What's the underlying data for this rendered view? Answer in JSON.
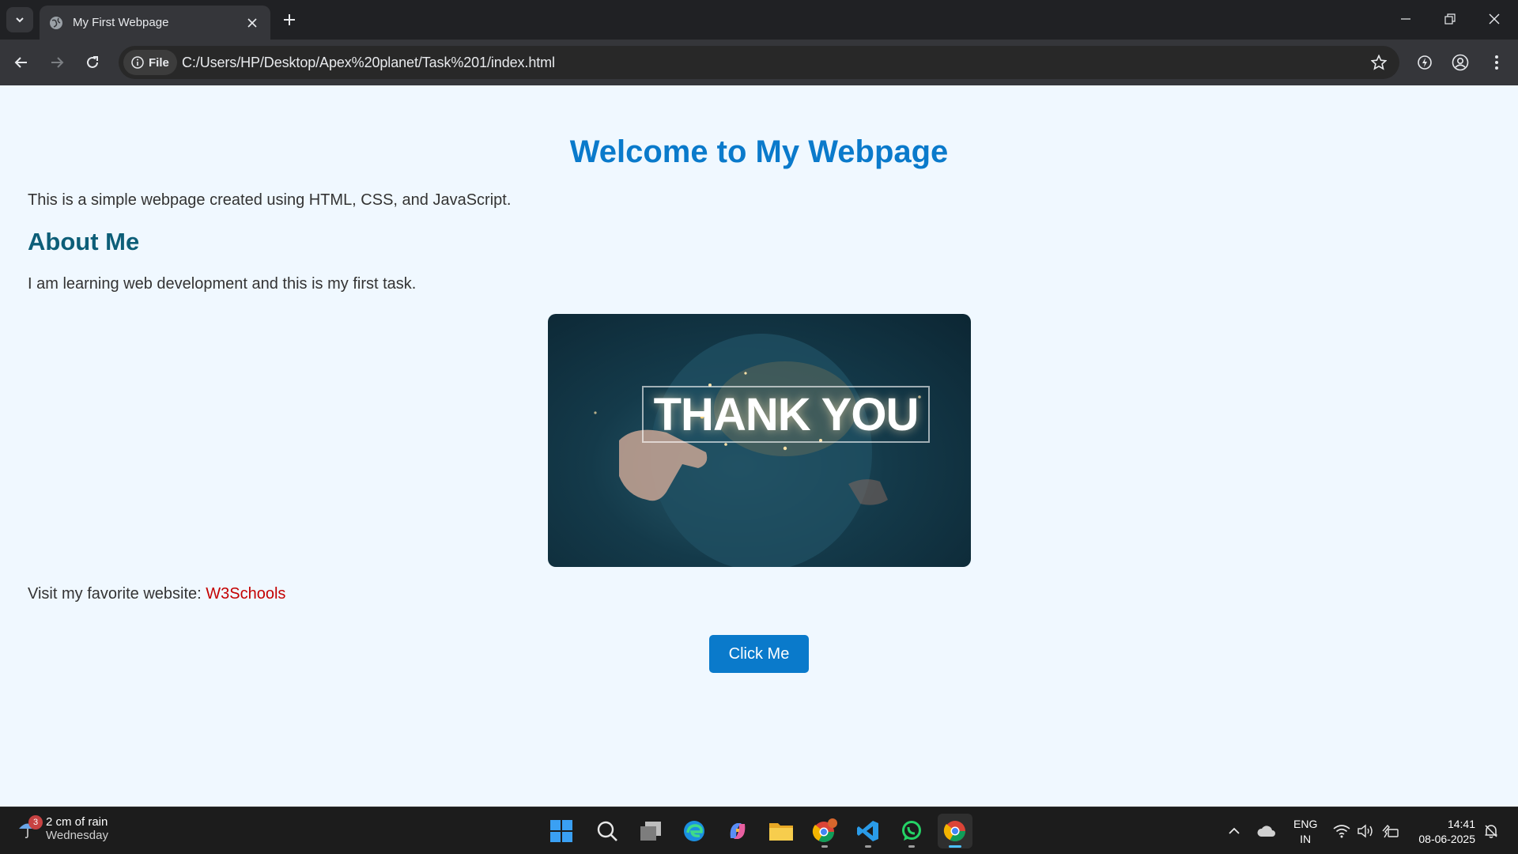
{
  "browser": {
    "tab_title": "My First Webpage",
    "site_chip": "File",
    "url": "C:/Users/HP/Desktop/Apex%20planet/Task%201/index.html"
  },
  "page": {
    "title": "Welcome to My Webpage",
    "intro": "This is a simple webpage created using HTML, CSS, and JavaScript.",
    "about_heading": "About Me",
    "about_text": "I am learning web development and this is my first task.",
    "image_text": "THANK YOU",
    "visit_prefix": "Visit my favorite website: ",
    "visit_link": "W3Schools",
    "button_label": "Click Me"
  },
  "colors": {
    "page_bg": "#f0f8ff",
    "title": "#0a7acb",
    "heading": "#0d5e78",
    "link": "#c40000",
    "button": "#0a7acb"
  },
  "taskbar": {
    "weather_badge": "3",
    "weather_main": "2 cm of rain",
    "weather_sub": "Wednesday",
    "apps": [
      "start-icon",
      "search-icon",
      "task-view-icon",
      "edge-icon",
      "copilot-icon",
      "file-explorer-icon",
      "chrome-profile-icon",
      "vscode-icon",
      "whatsapp-icon",
      "chrome-icon"
    ],
    "lang_line1": "ENG",
    "lang_line2": "IN",
    "time": "14:41",
    "date": "08-06-2025"
  }
}
